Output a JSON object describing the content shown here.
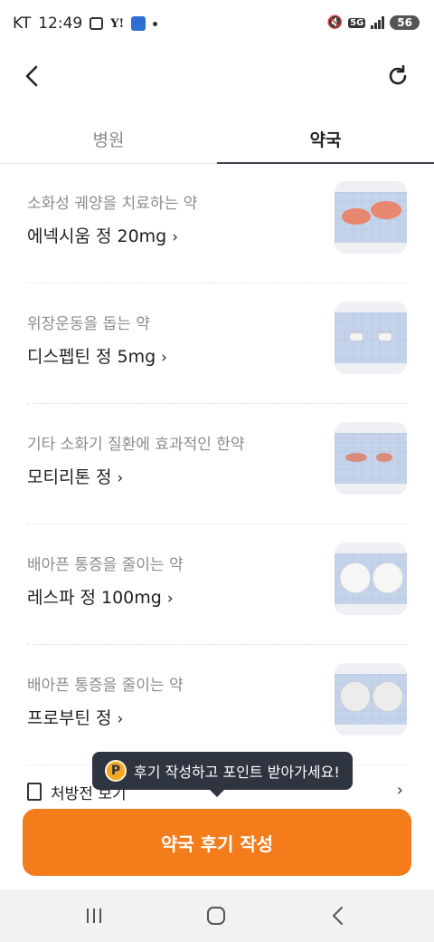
{
  "status_bar": {
    "carrier": "KT",
    "time": "12:49",
    "network": "5G",
    "battery": "56"
  },
  "app_bar": {
    "back_icon": "chevron-left-icon",
    "refresh_icon": "refresh-icon"
  },
  "tabs": [
    {
      "label": "병원",
      "selected": false
    },
    {
      "label": "약국",
      "selected": true
    }
  ],
  "medicines": [
    {
      "description": "소화성 궤양을 치료하는 약",
      "name": "에넥시움 정 20mg",
      "pill_color": "#e8876f",
      "pill_shape": "oval-large"
    },
    {
      "description": "위장운동을 돕는 약",
      "name": "디스펩틴 정 5mg",
      "pill_color": "#f4f4f4",
      "pill_shape": "oblong-small"
    },
    {
      "description": "기타 소화기 질환에 효과적인 한약",
      "name": "모티리톤 정",
      "pill_color": "#d98b7c",
      "pill_shape": "oval-small"
    },
    {
      "description": "배아픈 통증을 줄이는 약",
      "name": "레스파 정 100mg",
      "pill_color": "#f6f6f6",
      "pill_shape": "round"
    },
    {
      "description": "배아픈 통증을 줄이는 약",
      "name": "프로부틴 정",
      "pill_color": "#ececec",
      "pill_shape": "round"
    }
  ],
  "prescription_row": {
    "label": "처방전 보기",
    "icon": "document-icon"
  },
  "tooltip": {
    "badge": "P",
    "text": "후기 작성하고 포인트 받아가세요!"
  },
  "cta": {
    "label": "약국 후기 작성",
    "color": "#f47c1b"
  },
  "nav_bar": {
    "icons": [
      "recent-apps-icon",
      "home-icon",
      "back-icon"
    ]
  }
}
